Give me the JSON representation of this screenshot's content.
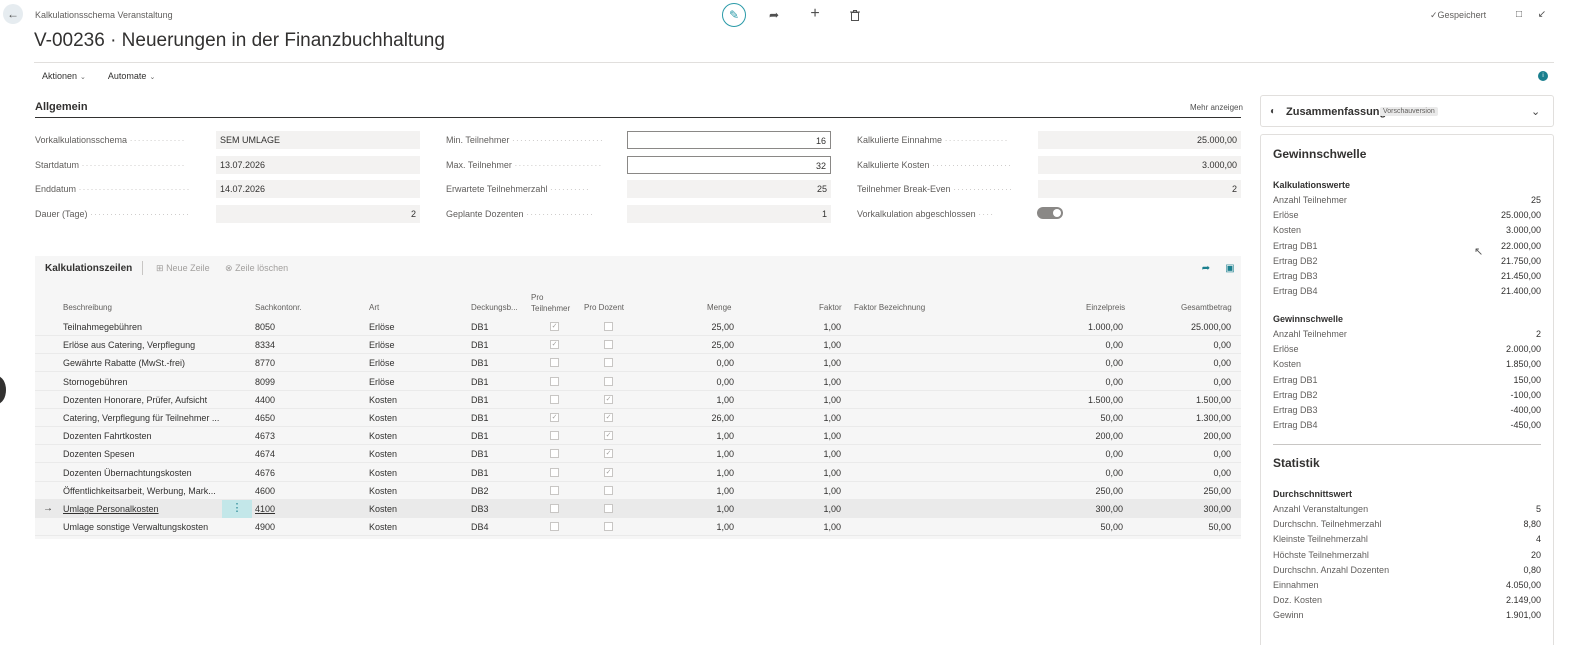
{
  "header": {
    "breadcrumb": "Kalkulationsschema Veranstaltung",
    "title": "V-00236 · Neuerungen in der Finanzbuchhaltung",
    "saved_label": "Gespeichert"
  },
  "actionbar": {
    "aktionen": "Aktionen",
    "automate": "Automate"
  },
  "allgemein": {
    "title": "Allgemein",
    "more": "Mehr anzeigen",
    "col1": [
      {
        "label": "Vorkalkulationsschema",
        "value": "SEM UMLAGE"
      },
      {
        "label": "Startdatum",
        "value": "13.07.2026"
      },
      {
        "label": "Enddatum",
        "value": "14.07.2026"
      },
      {
        "label": "Dauer (Tage)",
        "value": "2"
      }
    ],
    "col2": [
      {
        "label": "Min. Teilnehmer",
        "value": "16"
      },
      {
        "label": "Max. Teilnehmer",
        "value": "32"
      },
      {
        "label": "Erwartete Teilnehmerzahl",
        "value": "25"
      },
      {
        "label": "Geplante Dozenten",
        "value": "1"
      }
    ],
    "col3": [
      {
        "label": "Kalkulierte Einnahme",
        "value": "25.000,00"
      },
      {
        "label": "Kalkulierte Kosten",
        "value": "3.000,00"
      },
      {
        "label": "Teilnehmer Break-Even",
        "value": "2"
      },
      {
        "label": "Vorkalkulation abgeschlossen",
        "value": "on"
      }
    ]
  },
  "lines": {
    "title": "Kalkulationszeilen",
    "new_line": "Neue Zeile",
    "delete_line": "Zeile löschen",
    "columns": {
      "beschreibung": "Beschreibung",
      "sachkonto": "Sachkontonr.",
      "art": "Art",
      "deckung": "Deckungsb...",
      "pro_teilnehmer_1": "Pro",
      "pro_teilnehmer_2": "Teilnehmer",
      "pro_dozent": "Pro Dozent",
      "menge": "Menge",
      "faktor": "Faktor",
      "faktor_bez": "Faktor Bezeichnung",
      "einzelpreis": "Einzelpreis",
      "gesamtbetrag": "Gesamtbetrag"
    },
    "rows": [
      {
        "b": "Teilnahmegebühren",
        "s": "8050",
        "a": "Erlöse",
        "d": "DB1",
        "pt": true,
        "pd": false,
        "m": "25,00",
        "f": "1,00",
        "e": "1.000,00",
        "g": "25.000,00"
      },
      {
        "b": "Erlöse aus Catering, Verpflegung",
        "s": "8334",
        "a": "Erlöse",
        "d": "DB1",
        "pt": true,
        "pd": false,
        "m": "25,00",
        "f": "1,00",
        "e": "0,00",
        "g": "0,00"
      },
      {
        "b": "Gewährte Rabatte (MwSt.-frei)",
        "s": "8770",
        "a": "Erlöse",
        "d": "DB1",
        "pt": false,
        "pd": false,
        "m": "0,00",
        "f": "1,00",
        "e": "0,00",
        "g": "0,00"
      },
      {
        "b": "Stornogebühren",
        "s": "8099",
        "a": "Erlöse",
        "d": "DB1",
        "pt": false,
        "pd": false,
        "m": "0,00",
        "f": "1,00",
        "e": "0,00",
        "g": "0,00"
      },
      {
        "b": "Dozenten Honorare, Prüfer, Aufsicht",
        "s": "4400",
        "a": "Kosten",
        "d": "DB1",
        "pt": false,
        "pd": true,
        "m": "1,00",
        "f": "1,00",
        "e": "1.500,00",
        "g": "1.500,00"
      },
      {
        "b": "Catering, Verpflegung für Teilnehmer ...",
        "s": "4650",
        "a": "Kosten",
        "d": "DB1",
        "pt": true,
        "pd": true,
        "m": "26,00",
        "f": "1,00",
        "e": "50,00",
        "g": "1.300,00"
      },
      {
        "b": "Dozenten Fahrtkosten",
        "s": "4673",
        "a": "Kosten",
        "d": "DB1",
        "pt": false,
        "pd": true,
        "m": "1,00",
        "f": "1,00",
        "e": "200,00",
        "g": "200,00"
      },
      {
        "b": "Dozenten Spesen",
        "s": "4674",
        "a": "Kosten",
        "d": "DB1",
        "pt": false,
        "pd": true,
        "m": "1,00",
        "f": "1,00",
        "e": "0,00",
        "g": "0,00"
      },
      {
        "b": "Dozenten Übernachtungskosten",
        "s": "4676",
        "a": "Kosten",
        "d": "DB1",
        "pt": false,
        "pd": true,
        "m": "1,00",
        "f": "1,00",
        "e": "0,00",
        "g": "0,00"
      },
      {
        "b": "Öffentlichkeitsarbeit, Werbung, Mark...",
        "s": "4600",
        "a": "Kosten",
        "d": "DB2",
        "pt": false,
        "pd": false,
        "m": "1,00",
        "f": "1,00",
        "e": "250,00",
        "g": "250,00"
      },
      {
        "b": "Umlage Personalkosten",
        "s": "4100",
        "a": "Kosten",
        "d": "DB3",
        "pt": false,
        "pd": false,
        "m": "1,00",
        "f": "1,00",
        "e": "300,00",
        "g": "300,00",
        "selected": true
      },
      {
        "b": "Umlage sonstige Verwaltungskosten",
        "s": "4900",
        "a": "Kosten",
        "d": "DB4",
        "pt": false,
        "pd": false,
        "m": "1,00",
        "f": "1,00",
        "e": "50,00",
        "g": "50,00"
      }
    ]
  },
  "factbox": {
    "title": "Zusammenfassung",
    "badge": "Vorschauversion",
    "gewinnschwelle_title": "Gewinnschwelle",
    "kalk_title": "Kalkulationswerte",
    "kalk": [
      {
        "k": "Anzahl Teilnehmer",
        "v": "25"
      },
      {
        "k": "Erlöse",
        "v": "25.000,00"
      },
      {
        "k": "Kosten",
        "v": "3.000,00"
      },
      {
        "k": "Ertrag DB1",
        "v": "22.000,00"
      },
      {
        "k": "Ertrag DB2",
        "v": "21.750,00"
      },
      {
        "k": "Ertrag DB3",
        "v": "21.450,00"
      },
      {
        "k": "Ertrag DB4",
        "v": "21.400,00"
      }
    ],
    "gew_title": "Gewinnschwelle",
    "gew": [
      {
        "k": "Anzahl Teilnehmer",
        "v": "2"
      },
      {
        "k": "Erlöse",
        "v": "2.000,00"
      },
      {
        "k": "Kosten",
        "v": "1.850,00"
      },
      {
        "k": "Ertrag DB1",
        "v": "150,00"
      },
      {
        "k": "Ertrag DB2",
        "v": "-100,00"
      },
      {
        "k": "Ertrag DB3",
        "v": "-400,00"
      },
      {
        "k": "Ertrag DB4",
        "v": "-450,00"
      }
    ],
    "statistik_title": "Statistik",
    "dw_title": "Durchschnittswert",
    "dw": [
      {
        "k": "Anzahl Veranstaltungen",
        "v": "5"
      },
      {
        "k": "Durchschn. Teilnehmerzahl",
        "v": "8,80"
      },
      {
        "k": "Kleinste Teilnehmerzahl",
        "v": "4"
      },
      {
        "k": "Höchste Teilnehmerzahl",
        "v": "20"
      },
      {
        "k": "Durchschn. Anzahl Dozenten",
        "v": "0,80"
      },
      {
        "k": "Einnahmen",
        "v": "4.050,00"
      },
      {
        "k": "Doz. Kosten",
        "v": "2.149,00"
      },
      {
        "k": "Gewinn",
        "v": "1.901,00"
      }
    ]
  }
}
